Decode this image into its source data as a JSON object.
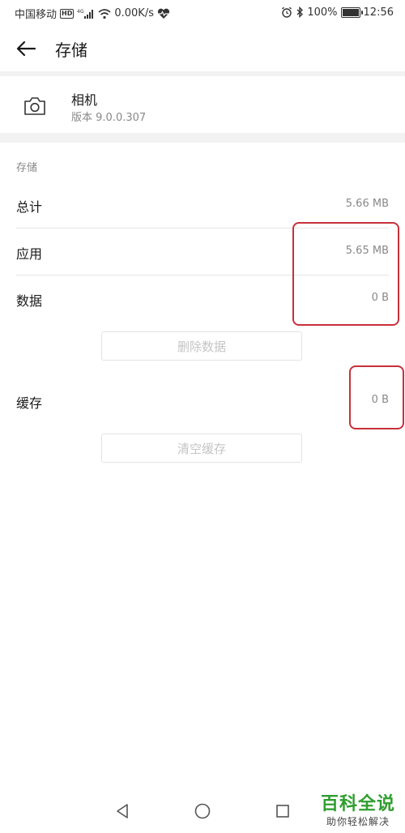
{
  "status_bar": {
    "carrier": "中国移动",
    "network": "4G",
    "speed": "0.00K/s",
    "battery": "100%",
    "battery_level": 1.0,
    "time": "12:56",
    "icons": [
      "hd-icon",
      "signal-icon",
      "wifi-icon",
      "heartbeat-icon",
      "alarm-icon",
      "bluetooth-icon",
      "battery-icon"
    ]
  },
  "header": {
    "title": "存储",
    "back_icon": "back-arrow-icon"
  },
  "app": {
    "icon": "camera-icon",
    "name": "相机",
    "version": "版本 9.0.0.307"
  },
  "storage": {
    "section_label": "存储",
    "rows": [
      {
        "label": "总计",
        "value": "5.66 MB"
      },
      {
        "label": "应用",
        "value": "5.65 MB"
      },
      {
        "label": "数据",
        "value": "0 B"
      }
    ],
    "delete_button": "删除数据"
  },
  "cache": {
    "label": "缓存",
    "value": "0 B",
    "clear_button": "清空缓存"
  },
  "annotation_color": "#c8303b",
  "nav_bar": {
    "icons": [
      "back-triangle-icon",
      "home-circle-icon",
      "recents-square-icon"
    ]
  },
  "watermark": {
    "brand": "百科全说",
    "slogan": "助你轻松解决",
    "brand_color": "#2f9e2f"
  }
}
